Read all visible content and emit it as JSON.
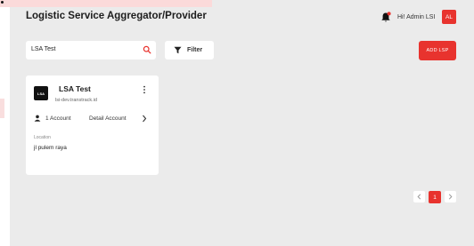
{
  "header": {
    "title": "Logistic Service Aggregator/Provider",
    "user_greeting": "Hi! Admin LSI",
    "avatar_initials": "AL",
    "icons": {
      "notification": "bell-icon"
    }
  },
  "toolbar": {
    "search_value": "LSA Test",
    "filter_label": "Filter",
    "add_button_label": "ADD LSP",
    "icons": {
      "search": "search-icon",
      "filter": "filter-icon"
    }
  },
  "cards": [
    {
      "logo_text": "LSA",
      "name": "LSA Test",
      "url": "lsi-dev.transtrack.id",
      "account_count": "1 Account",
      "detail_label": "Detail Account",
      "location_label": "Location",
      "location_value": "jl pulem raya"
    }
  ],
  "pagination": {
    "current_page": "1"
  },
  "colors": {
    "accent": "#e8332e",
    "background": "#ebebeb",
    "surface": "#ffffff"
  }
}
